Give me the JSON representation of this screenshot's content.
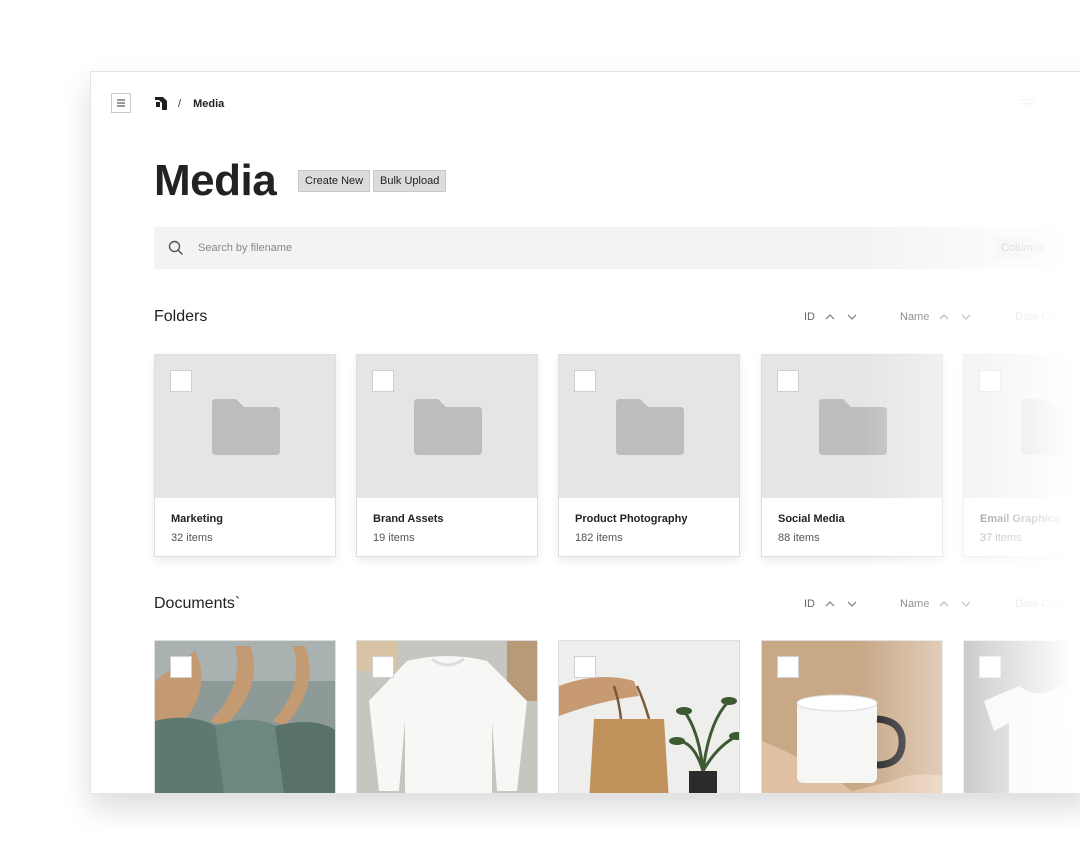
{
  "breadcrumb": {
    "separator": "/",
    "current": "Media"
  },
  "page": {
    "title": "Media",
    "create_label": "Create New",
    "upload_label": "Bulk Upload"
  },
  "search": {
    "placeholder": "Search by filename",
    "columns_label": "Columns"
  },
  "folders": {
    "title": "Folders",
    "sort": {
      "id": "ID",
      "name": "Name",
      "date": "Date Cre"
    },
    "items": [
      {
        "name": "Marketing",
        "count": "32 items"
      },
      {
        "name": "Brand Assets",
        "count": "19 items"
      },
      {
        "name": "Product Photography",
        "count": "182 items"
      },
      {
        "name": "Social Media",
        "count": "88 items"
      },
      {
        "name": "Email Graphics",
        "count": "37 items"
      }
    ]
  },
  "documents": {
    "title": "Documents`",
    "sort": {
      "id": "ID",
      "name": "Name",
      "date": "Date Cre"
    },
    "items": [
      {
        "icon": "hangers-photo"
      },
      {
        "icon": "sweatshirt-photo"
      },
      {
        "icon": "tote-bag-photo"
      },
      {
        "icon": "mug-photo"
      },
      {
        "icon": "tshirt-photo"
      }
    ]
  },
  "colors": {
    "accent": "#1f1f1f",
    "thumb_bg": "#e5e5e5",
    "folder_icon": "#bdbdbd",
    "search_bg": "#f3f3f3"
  }
}
